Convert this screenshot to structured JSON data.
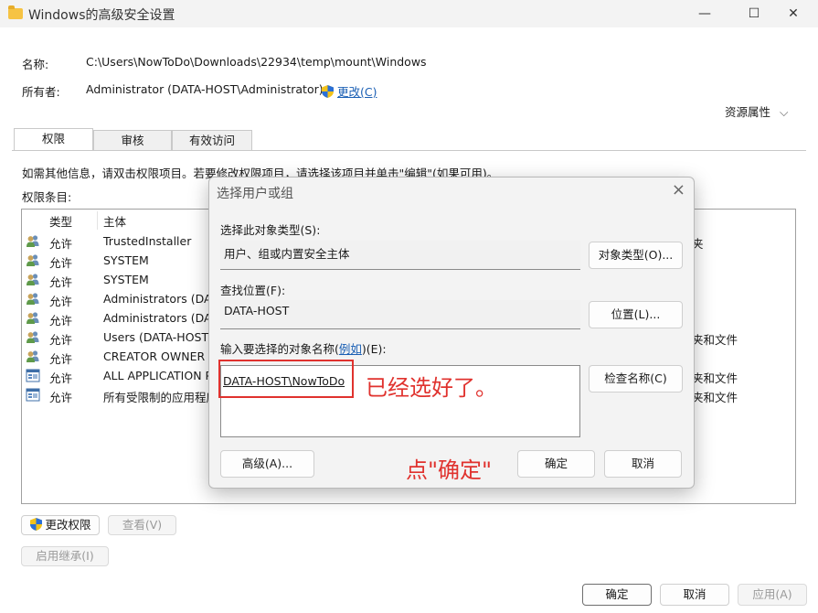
{
  "window": {
    "title": "Windows的高级安全设置",
    "controls": [
      "—",
      "☐",
      "✕"
    ]
  },
  "header": {
    "name_label": "名称:",
    "name_value": "C:\\Users\\NowToDo\\Downloads\\22934\\temp\\mount\\Windows",
    "owner_label": "所有者:",
    "owner_value": "Administrator (DATA-HOST\\Administrator)",
    "owner_change": "更改(C)",
    "resource_props": "资源属性",
    "resource_chevron": "⌵"
  },
  "tabs": [
    "权限",
    "审核",
    "有效访问"
  ],
  "info_text": "如需其他信息，请双击权限项目。若要修改权限项目，请选择该项目并单击\"编辑\"(如果可用)。",
  "entries_label": "权限条目:",
  "table": {
    "columns": [
      "类型",
      "主体"
    ],
    "rows": [
      {
        "icon": "users",
        "type": "允许",
        "principal": "TrustedInstaller",
        "tail": "夹"
      },
      {
        "icon": "users",
        "type": "允许",
        "principal": "SYSTEM",
        "tail": ""
      },
      {
        "icon": "users",
        "type": "允许",
        "principal": "SYSTEM",
        "tail": ""
      },
      {
        "icon": "users",
        "type": "允许",
        "principal": "Administrators (DAT",
        "tail": ""
      },
      {
        "icon": "users",
        "type": "允许",
        "principal": "Administrators (DAT",
        "tail": ""
      },
      {
        "icon": "users",
        "type": "允许",
        "principal": "Users (DATA-HOST\\",
        "tail": "夹和文件"
      },
      {
        "icon": "users",
        "type": "允许",
        "principal": "CREATOR OWNER",
        "tail": ""
      },
      {
        "icon": "app",
        "type": "允许",
        "principal": "ALL APPLICATION P",
        "tail": "夹和文件"
      },
      {
        "icon": "app",
        "type": "允许",
        "principal": "所有受限制的应用程序",
        "tail": "夹和文件"
      }
    ]
  },
  "buttons": {
    "change_perms": "更改权限",
    "view": "查看(V)",
    "inherit": "启用继承(I)",
    "ok": "确定",
    "cancel": "取消",
    "apply": "应用(A)"
  },
  "dialog": {
    "title": "选择用户或组",
    "object_type_label": "选择此对象类型(S):",
    "object_type_value": "用户、组或内置安全主体",
    "object_type_button": "对象类型(O)...",
    "location_label": "查找位置(F):",
    "location_value": "DATA-HOST",
    "location_button": "位置(L)...",
    "names_label_pre": "输入要选择的对象名称(",
    "names_label_link": "例如",
    "names_label_post": ")(E):",
    "names_value": "DATA-HOST\\NowToDo",
    "check_names_button": "检查名称(C)",
    "advanced_button": "高级(A)...",
    "ok_button": "确定",
    "cancel_button": "取消"
  },
  "annotations": {
    "selected_note": "已经选好了。",
    "click_ok_note": "点\"确定\""
  },
  "colors": {
    "annotation_red": "#e0322e",
    "link_blue": "#1a5fb4",
    "folder_yellow": "#f6c343"
  }
}
